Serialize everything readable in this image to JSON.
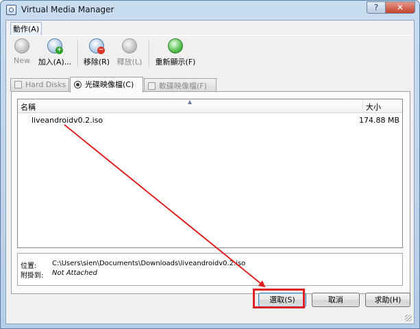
{
  "window": {
    "title": "Virtual Media Manager",
    "help": "?",
    "close": "✕"
  },
  "menu": {
    "action": "動作(A)"
  },
  "toolbar": {
    "new": "New",
    "add": "加入(A)...",
    "remove": "移除(R)",
    "release": "釋放(L)",
    "refresh": "重新顯示(F)"
  },
  "tabs": {
    "hard_disks": "Hard Disks",
    "cd_images": "光碟映像檔(C)",
    "floppy_images": "軟碟映像檔(F)"
  },
  "list": {
    "col_name": "名稱",
    "col_size": "大小",
    "rows": [
      {
        "name": "liveandroidv0.2.iso",
        "size": "174.88 MB"
      }
    ]
  },
  "info": {
    "location_label": "位置:",
    "location_value": "C:\\Users\\sien\\Documents\\Downloads\\liveandroidv0.2.iso",
    "attached_label": "附掛到:",
    "attached_value": "Not Attached"
  },
  "buttons": {
    "select": "選取(S)",
    "cancel": "取消",
    "help": "求助(H)"
  },
  "colors": {
    "annotation": "#e02020"
  }
}
